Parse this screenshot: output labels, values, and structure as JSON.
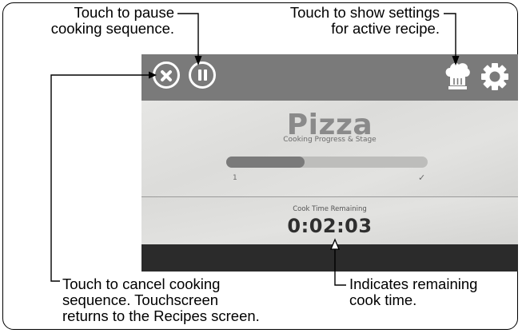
{
  "callouts": {
    "pause": [
      "Touch to pause",
      "cooking sequence."
    ],
    "settings": [
      "Touch to show settings",
      "for active recipe."
    ],
    "cancel": [
      "Touch to cancel cooking",
      "sequence. Touchscreen",
      "returns to the Recipes screen."
    ],
    "remaining": [
      "Indicates remaining",
      "cook time."
    ]
  },
  "screen": {
    "recipe_title": "Pizza",
    "subtitle": "Cooking Progress & Stage",
    "progress": {
      "fraction": 0.39,
      "stage_start": "1",
      "stage_end": "✓"
    },
    "cook_time_label": "Cook Time Remaining",
    "cook_time": "0:02:03"
  },
  "icons": [
    "cancel-icon",
    "pause-icon",
    "chef-hat-icon",
    "gear-icon"
  ],
  "colors": {
    "topbar": "#7a7a7a",
    "bottom_bar": "#2b2b2b",
    "progress_fill": "#7a7a7a"
  }
}
